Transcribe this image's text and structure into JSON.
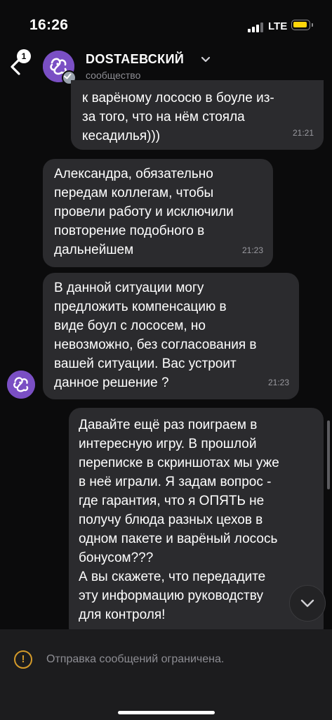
{
  "status_bar": {
    "time": "16:26",
    "network": "LTE"
  },
  "header": {
    "unread_count": "1",
    "title": "DOSTAEВСКИЙ",
    "subtitle": "сообщество"
  },
  "messages": [
    {
      "direction": "out",
      "text": "к варёному лососю в боуле из-\nза того, что на нём стояла\nкесадилья)))",
      "time": "21:21"
    },
    {
      "direction": "in",
      "text": "Александра, обязательно\nпередам коллегам, чтобы\nпровели работу и исключили\nповторение подобного в\nдальнейшем",
      "time": "21:23"
    },
    {
      "direction": "in",
      "text": "В данной ситуации могу\nпредложить компенсацию в\nвиде боул с лососем, но\nневозможно, без согласования в\nвашей ситуации. Вас устроит\nданное решение ?",
      "time": "21:23"
    },
    {
      "direction": "out",
      "text": "Давайте ещё раз поиграем в\nинтересную игру. В прошлой\nпереписке в скриншотах мы уже\nв неё играли. Я задам вопрос -\nгде гарантия, что я ОПЯТЬ не\nполучу блюда разных цехов в\nодном пакете и варёный лосось\nбонусом???\nА вы скажете, что передадите\nэту информацию руководству\nдля контроля!",
      "time": ""
    }
  ],
  "footer": {
    "notice": "Отправка сообщений ограничена."
  },
  "colors": {
    "bubble": "#2b2b2e",
    "background": "#0b0b0c",
    "avatar": "#7a4fc4",
    "warning": "#d49a2a",
    "battery": "#ffd60a"
  }
}
